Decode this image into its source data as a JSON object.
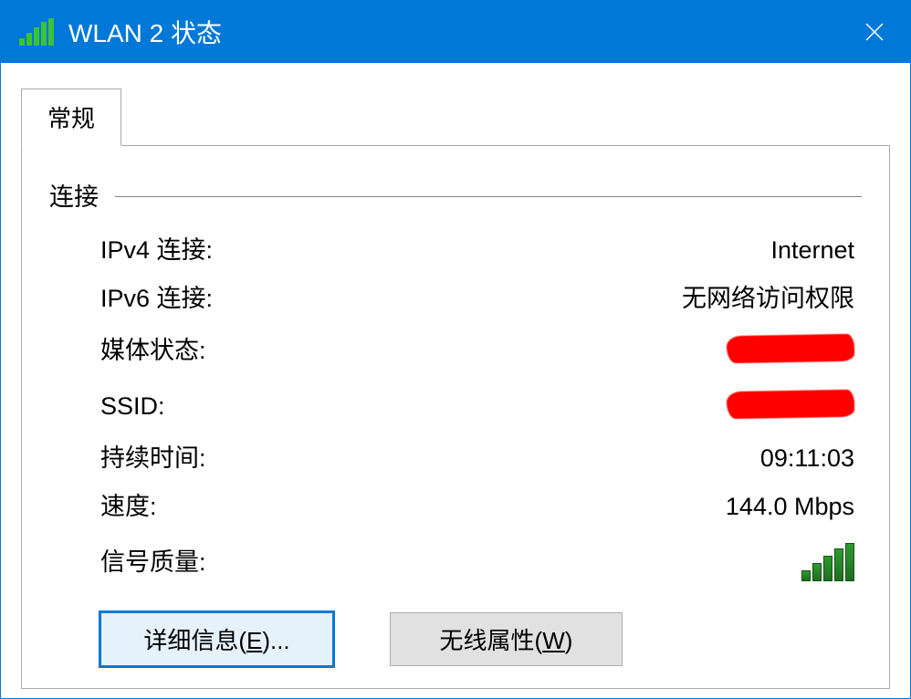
{
  "titlebar": {
    "title": "WLAN 2 状态"
  },
  "tabs": {
    "general": "常规"
  },
  "groupbox": {
    "connection_label": "连接"
  },
  "fields": {
    "ipv4_label": "IPv4 连接:",
    "ipv4_value": "Internet",
    "ipv6_label": "IPv6 连接:",
    "ipv6_value": "无网络访问权限",
    "media_state_label": "媒体状态:",
    "media_state_value_redacted": true,
    "ssid_label": "SSID:",
    "ssid_value_redacted": true,
    "duration_label": "持续时间:",
    "duration_value": "09:11:03",
    "speed_label": "速度:",
    "speed_value": "144.0 Mbps",
    "signal_quality_label": "信号质量:"
  },
  "signal_bars": 5,
  "buttons": {
    "details_prefix": "详细信息(",
    "details_hotkey": "E",
    "details_suffix": ")...",
    "wireless_prefix": "无线属性(",
    "wireless_hotkey": "W",
    "wireless_suffix": ")"
  }
}
